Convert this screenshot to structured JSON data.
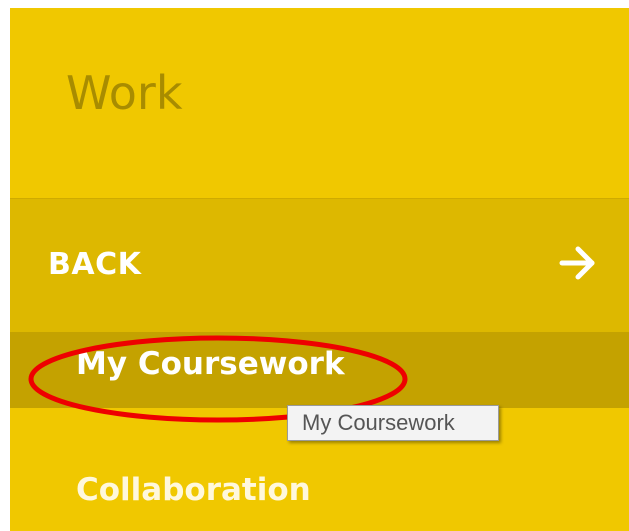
{
  "header": {
    "title": "Work"
  },
  "back": {
    "label": "BACK",
    "icon": "arrow-right-icon"
  },
  "menu": {
    "items": [
      {
        "label": "My Coursework",
        "active": true
      },
      {
        "label": "Collaboration",
        "active": false
      }
    ]
  },
  "tooltip": {
    "text": "My Coursework"
  },
  "annotation": {
    "color": "#ee0000"
  },
  "colors": {
    "panel": "#f0c800",
    "back_row": "#ddb800",
    "active_item": "#c4a200",
    "title_text": "#a88c00"
  }
}
